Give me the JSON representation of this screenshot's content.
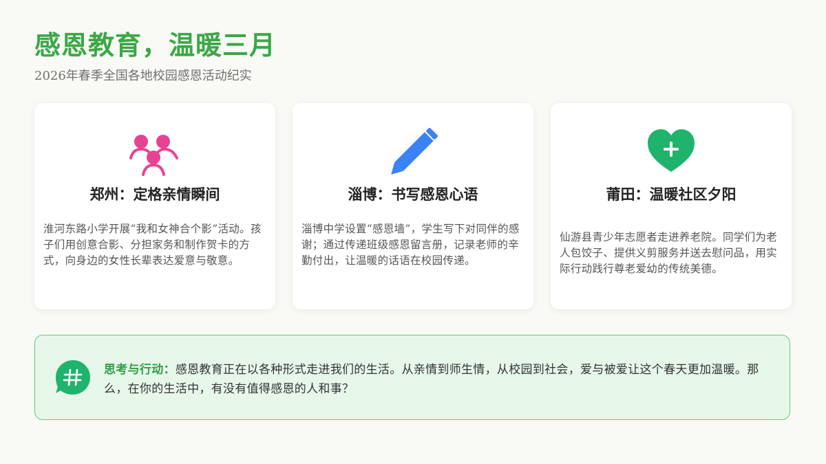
{
  "header": {
    "title": "感恩教育，温暖三月",
    "subtitle": "2026年春季全国各地校园感恩活动纪实"
  },
  "cards": [
    {
      "icon": "people-group-icon",
      "icon_color": "#e84393",
      "title": "郑州：定格亲情瞬间",
      "text": "淮河东路小学开展“我和女神合个影”活动。孩子们用创意合影、分担家务和制作贺卡的方式，向身边的女性长辈表达爱意与敬意。"
    },
    {
      "icon": "pencil-icon",
      "icon_color": "#3b82f6",
      "title": "淄博：书写感恩心语",
      "text": "淄博中学设置“感恩墙”，学生写下对同伴的感谢；通过传递班级感恩留言册，记录老师的辛勤付出，让温暖的话语在校园传递。"
    },
    {
      "icon": "heart-plus-icon",
      "icon_color": "#1fb36b",
      "title": "莆田：温暖社区夕阳",
      "text": "仙游县青少年志愿者走进养老院。同学们为老人包饺子、提供义剪服务并送去慰问品，用实际行动践行尊老爱幼的传统美德。"
    }
  ],
  "callout": {
    "icon": "hashtag-chat-icon",
    "icon_color": "#1fb36b",
    "label": "思考与行动：",
    "text": "感恩教育正在以各种形式走进我们的生活。从亲情到师生情，从校园到社会，爱与被爱让这个春天更加温暖。那么，在你的生活中，有没有值得感恩的人和事？"
  },
  "colors": {
    "accent_green": "#3aa845",
    "background": "#f9f9f6",
    "callout_bg": "#e6f7ea",
    "callout_border": "#6cc77a"
  }
}
